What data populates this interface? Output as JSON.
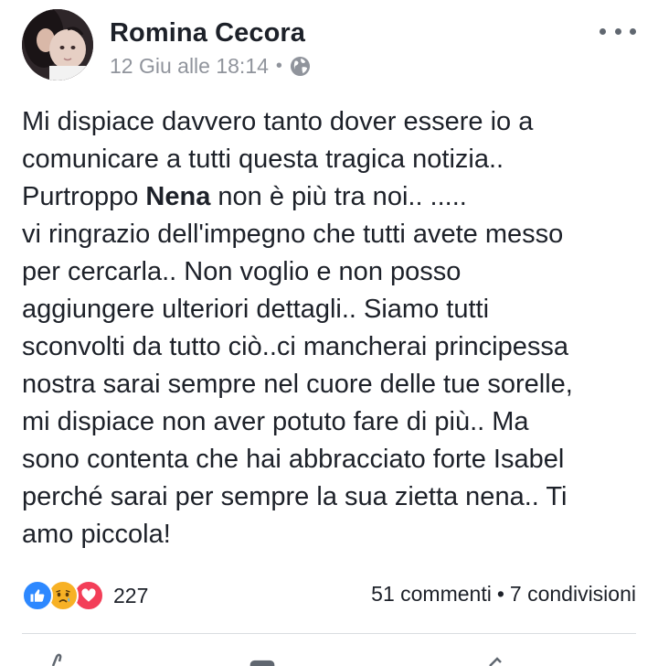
{
  "post": {
    "author": "Romina Cecora",
    "timestamp": "12 Giu alle 18:14",
    "separator": "•",
    "privacy_icon": "globe-icon",
    "more_icon": "more-dots-icon",
    "text_lines": [
      [
        "Mi dispiace davvero tanto dover essere io a"
      ],
      [
        "comunicare a tutti questa tragica notizia.."
      ],
      [
        "Purtroppo ",
        "Nena",
        " non è più tra noi.. ....."
      ],
      [
        "vi ringrazio dell'impegno che tutti avete messo"
      ],
      [
        "per cercarla.. Non voglio e non posso"
      ],
      [
        "aggiungere ulteriori dettagli.. Siamo tutti"
      ],
      [
        "sconvolti da tutto ciò..ci mancherai principessa"
      ],
      [
        "nostra sarai sempre nel cuore delle tue sorelle,"
      ],
      [
        "mi dispiace non aver potuto fare di più.. Ma"
      ],
      [
        "sono contenta che hai abbracciato forte Isabel"
      ],
      [
        "perché sarai per sempre la sua zietta nena.. Ti"
      ],
      [
        "amo piccola!"
      ]
    ]
  },
  "stats": {
    "reactions": [
      "like-icon",
      "sad-icon",
      "love-icon"
    ],
    "reaction_count": "227",
    "comments": "51 commenti",
    "dot": "•",
    "shares": "7 condivisioni"
  },
  "colors": {
    "like": "#2d88ff",
    "sad": "#f7b125",
    "love": "#f33e58",
    "meta_text": "#90949c"
  }
}
